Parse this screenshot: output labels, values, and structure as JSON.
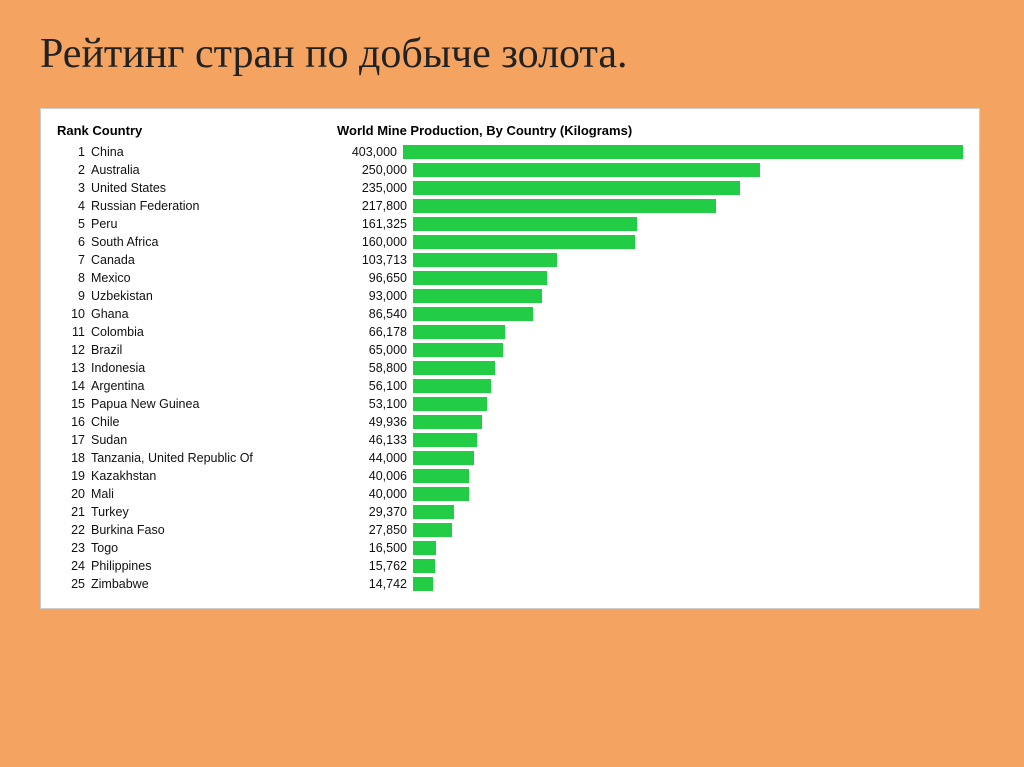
{
  "title": "Рейтинг стран по добыче золота.",
  "header": {
    "rank_country": "Rank Country",
    "production": "World Mine Production, By Country (Kilograms)"
  },
  "max_value": 403000,
  "bar_max_width": 560,
  "rows": [
    {
      "rank": 1,
      "country": "China",
      "value": 403000,
      "value_str": "403,000"
    },
    {
      "rank": 2,
      "country": "Australia",
      "value": 250000,
      "value_str": "250,000"
    },
    {
      "rank": 3,
      "country": "United States",
      "value": 235000,
      "value_str": "235,000"
    },
    {
      "rank": 4,
      "country": "Russian Federation",
      "value": 217800,
      "value_str": "217,800"
    },
    {
      "rank": 5,
      "country": "Peru",
      "value": 161325,
      "value_str": "161,325"
    },
    {
      "rank": 6,
      "country": "South Africa",
      "value": 160000,
      "value_str": "160,000"
    },
    {
      "rank": 7,
      "country": "Canada",
      "value": 103713,
      "value_str": "103,713"
    },
    {
      "rank": 8,
      "country": "Mexico",
      "value": 96650,
      "value_str": "96,650"
    },
    {
      "rank": 9,
      "country": "Uzbekistan",
      "value": 93000,
      "value_str": "93,000"
    },
    {
      "rank": 10,
      "country": "Ghana",
      "value": 86540,
      "value_str": "86,540"
    },
    {
      "rank": 11,
      "country": "Colombia",
      "value": 66178,
      "value_str": "66,178"
    },
    {
      "rank": 12,
      "country": "Brazil",
      "value": 65000,
      "value_str": "65,000"
    },
    {
      "rank": 13,
      "country": "Indonesia",
      "value": 58800,
      "value_str": "58,800"
    },
    {
      "rank": 14,
      "country": "Argentina",
      "value": 56100,
      "value_str": "56,100"
    },
    {
      "rank": 15,
      "country": "Papua New Guinea",
      "value": 53100,
      "value_str": "53,100"
    },
    {
      "rank": 16,
      "country": "Chile",
      "value": 49936,
      "value_str": "49,936"
    },
    {
      "rank": 17,
      "country": "Sudan",
      "value": 46133,
      "value_str": "46,133"
    },
    {
      "rank": 18,
      "country": "Tanzania, United Republic Of",
      "value": 44000,
      "value_str": "44,000"
    },
    {
      "rank": 19,
      "country": "Kazakhstan",
      "value": 40006,
      "value_str": "40,006"
    },
    {
      "rank": 20,
      "country": "Mali",
      "value": 40000,
      "value_str": "40,000"
    },
    {
      "rank": 21,
      "country": "Turkey",
      "value": 29370,
      "value_str": "29,370"
    },
    {
      "rank": 22,
      "country": "Burkina Faso",
      "value": 27850,
      "value_str": "27,850"
    },
    {
      "rank": 23,
      "country": "Togo",
      "value": 16500,
      "value_str": "16,500"
    },
    {
      "rank": 24,
      "country": "Philippines",
      "value": 15762,
      "value_str": "15,762"
    },
    {
      "rank": 25,
      "country": "Zimbabwe",
      "value": 14742,
      "value_str": "14,742"
    }
  ]
}
